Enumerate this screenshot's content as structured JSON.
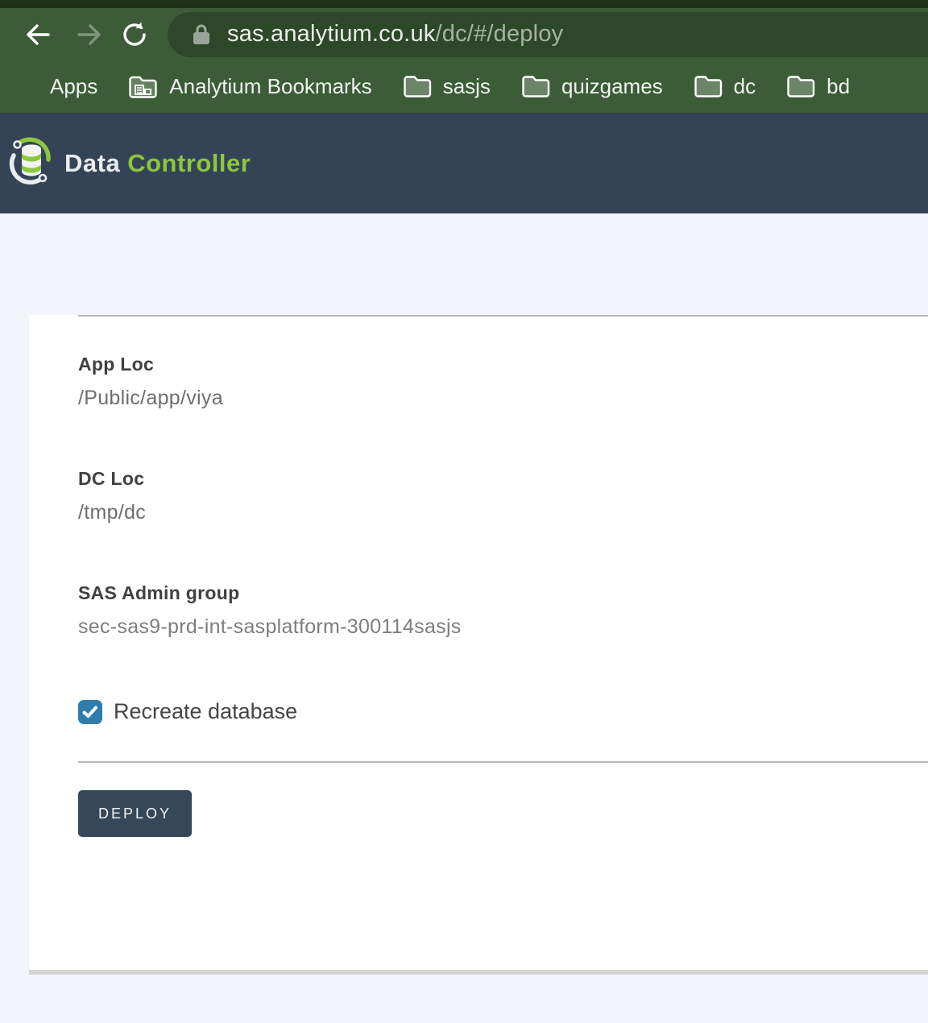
{
  "browser": {
    "toolbar": {
      "back_icon": "back-arrow",
      "forward_icon": "forward-arrow",
      "reload_icon": "reload-arrow"
    },
    "omnibox": {
      "lock_icon": "padlock",
      "url_host": "sas.analytium.co.uk",
      "url_path": "/dc/#/deploy"
    },
    "bookmarks_bar": {
      "apps": {
        "label": "Apps",
        "icon": "apps-grid-icon"
      },
      "items": [
        {
          "label": "Analytium Bookmarks",
          "icon": "managed-bookmarks-folder-icon"
        },
        {
          "label": "sasjs",
          "icon": "folder-icon"
        },
        {
          "label": "quizgames",
          "icon": "folder-icon"
        },
        {
          "label": "dc",
          "icon": "folder-icon"
        },
        {
          "label": "bd",
          "icon": "folder-icon"
        }
      ]
    }
  },
  "app_header": {
    "logo_icon": "database-with-arcs",
    "brand_primary": "Data",
    "brand_secondary": "Controller"
  },
  "deploy_form": {
    "fields": [
      {
        "label": "App Loc",
        "value": "/Public/app/viya"
      },
      {
        "label": "DC Loc",
        "value": "/tmp/dc"
      },
      {
        "label": "SAS Admin group",
        "value": "sec-sas9-prd-int-sasplatform-300114sasjs"
      }
    ],
    "checkbox": {
      "label": "Recreate database",
      "checked": true
    },
    "submit_label": "DEPLOY"
  },
  "colors": {
    "chrome_green": "#3b5c37",
    "omnibox_green": "#2d4828",
    "window_strip_green": "#1e3119",
    "header_slate": "#344456",
    "brand_green": "#8dc63f",
    "checkbox_blue": "#2e7dad",
    "button_slate": "#364758",
    "page_background": "#f4f4fd",
    "apps_icon_palette": [
      "#dd5145",
      "#5b9a5f",
      "#4a7fe8",
      "#dd9b3d"
    ]
  }
}
